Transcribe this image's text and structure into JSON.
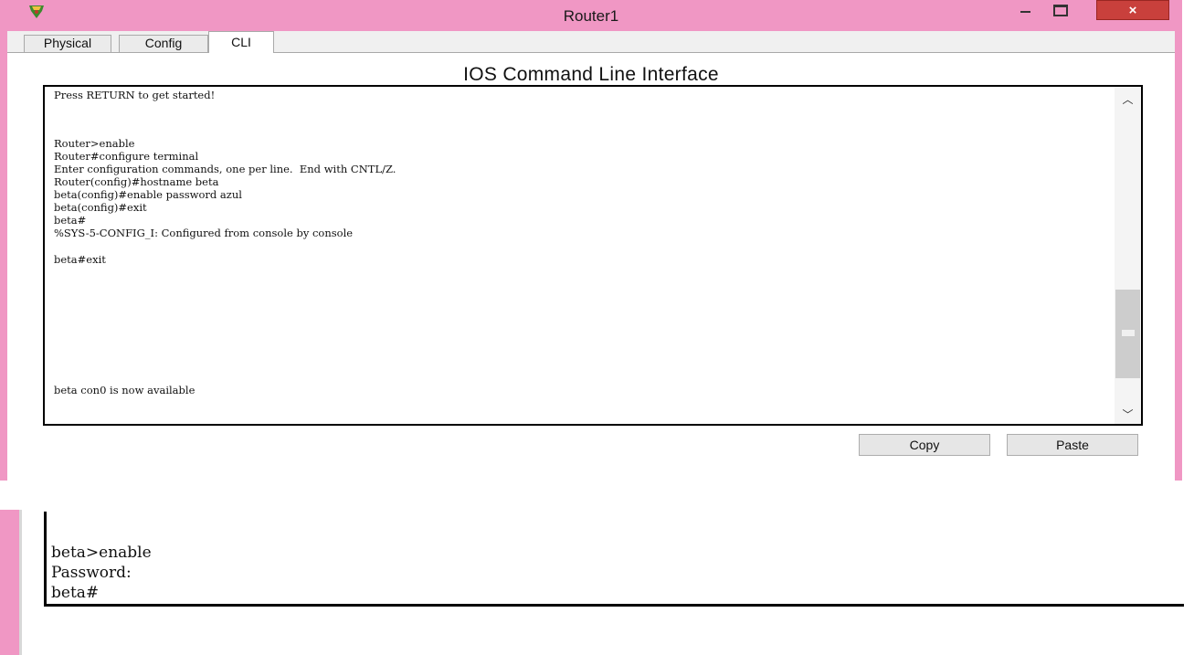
{
  "window": {
    "title": "Router1",
    "close_glyph": "×",
    "tabs": [
      "Physical",
      "Config",
      "CLI"
    ],
    "active_tab": "CLI"
  },
  "cli": {
    "heading": "IOS Command Line Interface",
    "lines": [
      "Press RETURN to get started!",
      "",
      "",
      "Router>enable",
      "Router#configure terminal",
      "Enter configuration commands, one per line.  End with CNTL/Z.",
      "Router(config)#hostname beta",
      "beta(config)#enable password azul",
      "beta(config)#exit",
      "beta#",
      "%SYS-5-CONFIG_I: Configured from console by console",
      "beta#exit",
      "beta con0 is now available"
    ],
    "scroll_up_glyph": "︿",
    "scroll_down_glyph": "﹀"
  },
  "buttons": {
    "copy": "Copy",
    "paste": "Paste"
  },
  "snippet": {
    "lines": [
      "beta>enable",
      "Password:",
      "beta#"
    ]
  },
  "colors": {
    "window_frame": "#f097c4",
    "close_button": "#c9403c"
  },
  "icons": {
    "app": "router-app-icon",
    "minimize": "minimize-icon",
    "maximize": "maximize-icon",
    "close": "close-icon"
  }
}
